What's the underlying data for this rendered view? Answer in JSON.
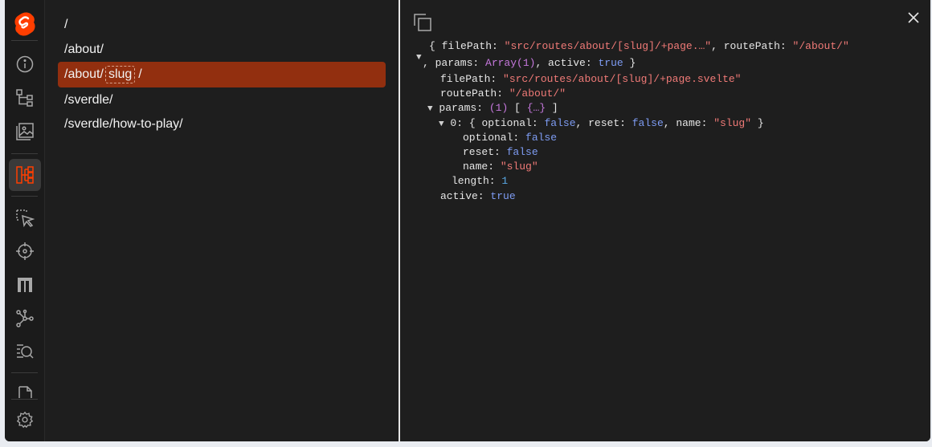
{
  "sidebar": {
    "items": [
      {
        "name": "svelte-logo-icon"
      },
      {
        "name": "info-icon"
      },
      {
        "name": "component-tree-icon"
      },
      {
        "name": "image-icon"
      },
      {
        "name": "routes-icon",
        "active": true
      },
      {
        "name": "inspect-select-icon"
      },
      {
        "name": "target-icon"
      },
      {
        "name": "layout-icon"
      },
      {
        "name": "graph-icon"
      },
      {
        "name": "search-list-icon"
      },
      {
        "name": "document-icon"
      },
      {
        "name": "gear-icon"
      }
    ]
  },
  "routes": [
    {
      "text": "/",
      "selected": false
    },
    {
      "text": "/about/",
      "selected": false
    },
    {
      "prefix": "/about/",
      "param": "slug",
      "suffix": "/",
      "selected": true
    },
    {
      "text": "/sverdle/",
      "selected": false
    },
    {
      "text": "/sverdle/how-to-play/",
      "selected": false
    }
  ],
  "inspector": {
    "summary_open": "{",
    "summary_filepath_key": "filePath:",
    "summary_filepath_val": "\"src/routes/about/[slug]/+page.…\"",
    "summary_routepath_key": ", routePath:",
    "summary_routepath_val": "\"/about/\"",
    "summary_params_key": ", params:",
    "summary_params_val": "Array(1)",
    "summary_active_key": ", active:",
    "summary_active_val": "true",
    "summary_close": "}",
    "filepath_key": "filePath:",
    "filepath_val": "\"src/routes/about/[slug]/+page.svelte\"",
    "routepath_key": "routePath:",
    "routepath_val": "\"/about/\"",
    "params_key": "params:",
    "params_count": "(1)",
    "params_open": "[",
    "params_preview": "{…}",
    "params_close": "]",
    "item0_key": "0:",
    "item0_open": "{",
    "item0_optional_key": "optional:",
    "item0_optional_val": "false",
    "item0_reset_key": ", reset:",
    "item0_reset_val": "false",
    "item0_name_key": ", name:",
    "item0_name_val": "\"slug\"",
    "item0_close": "}",
    "optional_key": "optional:",
    "optional_val": "false",
    "reset_key": "reset:",
    "reset_val": "false",
    "name_key": "name:",
    "name_val": "\"slug\"",
    "length_key": "length:",
    "length_val": "1",
    "active_key": "active:",
    "active_val": "true",
    "arrow": "▼"
  }
}
